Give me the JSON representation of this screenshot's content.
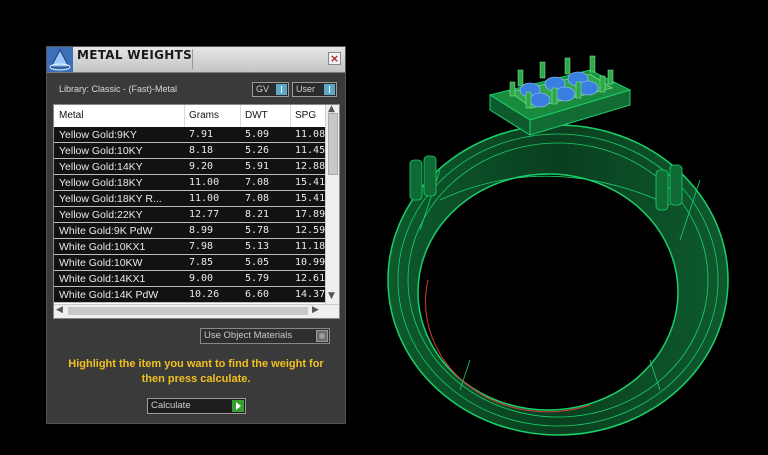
{
  "panel": {
    "title": "METAL WEIGHTS",
    "close_label": "×",
    "library_label": "Library: Classic - (Fast)-Metal",
    "dropdown_gv": "GV",
    "dropdown_user": "User",
    "use_object_materials": "Use Object Materials",
    "hint": "Highlight the item you want to find the weight for then press calculate.",
    "calculate_label": "Calculate"
  },
  "table": {
    "headers": [
      "Metal",
      "Grams",
      "DWT",
      "SPG"
    ],
    "rows": [
      [
        "Yellow Gold:9KY",
        "7.91",
        "5.09",
        "11.08"
      ],
      [
        "Yellow Gold:10KY",
        "8.18",
        "5.26",
        "11.45"
      ],
      [
        "Yellow Gold:14KY",
        "9.20",
        "5.91",
        "12.88"
      ],
      [
        "Yellow Gold:18KY",
        "11.00",
        "7.08",
        "15.41"
      ],
      [
        "Yellow Gold:18KY R...",
        "11.00",
        "7.08",
        "15.41"
      ],
      [
        "Yellow Gold:22KY",
        "12.77",
        "8.21",
        "17.89"
      ],
      [
        "White Gold:9K PdW",
        "8.99",
        "5.78",
        "12.59"
      ],
      [
        "White Gold:10KX1",
        "7.98",
        "5.13",
        "11.18"
      ],
      [
        "White Gold:10KW",
        "7.85",
        "5.05",
        "10.99"
      ],
      [
        "White Gold:14KX1",
        "9.00",
        "5.79",
        "12.61"
      ],
      [
        "White Gold:14K PdW",
        "10.26",
        "6.60",
        "14.37"
      ]
    ],
    "scroll_up": "▲",
    "scroll_down": "▼",
    "scroll_left": "◀",
    "scroll_right": "▶"
  },
  "colors": {
    "ring_wire": "#19d06a",
    "ring_fill": "#0b4a26",
    "stones": "#3a7ee0",
    "prongs": "#2ea84a",
    "hint_text": "#f0c020"
  }
}
